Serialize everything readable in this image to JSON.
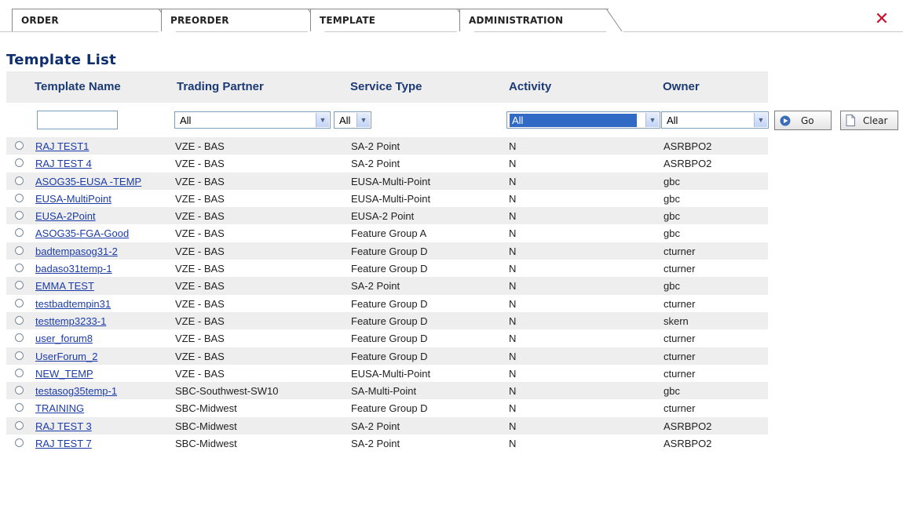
{
  "tabs": [
    {
      "label": "ORDER"
    },
    {
      "label": "PREORDER"
    },
    {
      "label": "TEMPLATE"
    },
    {
      "label": "ADMINISTRATION"
    }
  ],
  "close_icon": "close-icon",
  "page_title": "Template List",
  "columns": {
    "template_name": "Template Name",
    "trading_partner": "Trading Partner",
    "service_type": "Service Type",
    "activity": "Activity",
    "owner": "Owner"
  },
  "filters": {
    "template_name_value": "",
    "trading_partner_selected": "All",
    "service_type_selected": "All",
    "activity_selected": "All",
    "owner_selected": "All",
    "go_label": "Go",
    "clear_label": "Clear"
  },
  "rows": [
    {
      "name": "RAJ TEST1",
      "partner": "VZE - BAS",
      "service": "SA-2 Point",
      "activity": "N",
      "owner": "ASRBPO2"
    },
    {
      "name": "RAJ TEST 4",
      "partner": "VZE - BAS",
      "service": "SA-2 Point",
      "activity": "N",
      "owner": "ASRBPO2"
    },
    {
      "name": "ASOG35-EUSA -TEMP",
      "partner": "VZE - BAS",
      "service": "EUSA-Multi-Point",
      "activity": "N",
      "owner": "gbc"
    },
    {
      "name": "EUSA-MultiPoint",
      "partner": "VZE - BAS",
      "service": "EUSA-Multi-Point",
      "activity": "N",
      "owner": "gbc"
    },
    {
      "name": "EUSA-2Point",
      "partner": "VZE - BAS",
      "service": "EUSA-2 Point",
      "activity": "N",
      "owner": "gbc"
    },
    {
      "name": "ASOG35-FGA-Good",
      "partner": "VZE - BAS",
      "service": "Feature Group A",
      "activity": "N",
      "owner": "gbc"
    },
    {
      "name": "badtempasog31-2",
      "partner": "VZE - BAS",
      "service": "Feature Group D",
      "activity": "N",
      "owner": "cturner"
    },
    {
      "name": "badaso31temp-1",
      "partner": "VZE - BAS",
      "service": "Feature Group D",
      "activity": "N",
      "owner": "cturner"
    },
    {
      "name": "EMMA TEST",
      "partner": "VZE - BAS",
      "service": "SA-2 Point",
      "activity": "N",
      "owner": "gbc"
    },
    {
      "name": "testbadtempin31",
      "partner": "VZE - BAS",
      "service": "Feature Group D",
      "activity": "N",
      "owner": "cturner"
    },
    {
      "name": "testtemp3233-1",
      "partner": "VZE - BAS",
      "service": "Feature Group D",
      "activity": "N",
      "owner": "skern"
    },
    {
      "name": "user_forum8",
      "partner": "VZE - BAS",
      "service": "Feature Group D",
      "activity": "N",
      "owner": "cturner"
    },
    {
      "name": "UserForum_2",
      "partner": "VZE - BAS",
      "service": "Feature Group D",
      "activity": "N",
      "owner": "cturner"
    },
    {
      "name": "NEW_TEMP",
      "partner": "VZE - BAS",
      "service": "EUSA-Multi-Point",
      "activity": "N",
      "owner": "cturner"
    },
    {
      "name": "testasog35temp-1",
      "partner": "SBC-Southwest-SW10",
      "service": "SA-Multi-Point",
      "activity": "N",
      "owner": "gbc"
    },
    {
      "name": "TRAINING",
      "partner": "SBC-Midwest",
      "service": "Feature Group D",
      "activity": "N",
      "owner": "cturner"
    },
    {
      "name": "RAJ TEST 3",
      "partner": "SBC-Midwest",
      "service": "SA-2 Point",
      "activity": "N",
      "owner": "ASRBPO2"
    },
    {
      "name": "RAJ TEST 7",
      "partner": "SBC-Midwest",
      "service": "SA-2 Point",
      "activity": "N",
      "owner": "ASRBPO2"
    }
  ],
  "colors": {
    "title": "#0f2e6e",
    "header_text": "#1c3a74",
    "link": "#1c3ca8",
    "close": "#c8102e",
    "row_alt": "#eeeeee"
  }
}
